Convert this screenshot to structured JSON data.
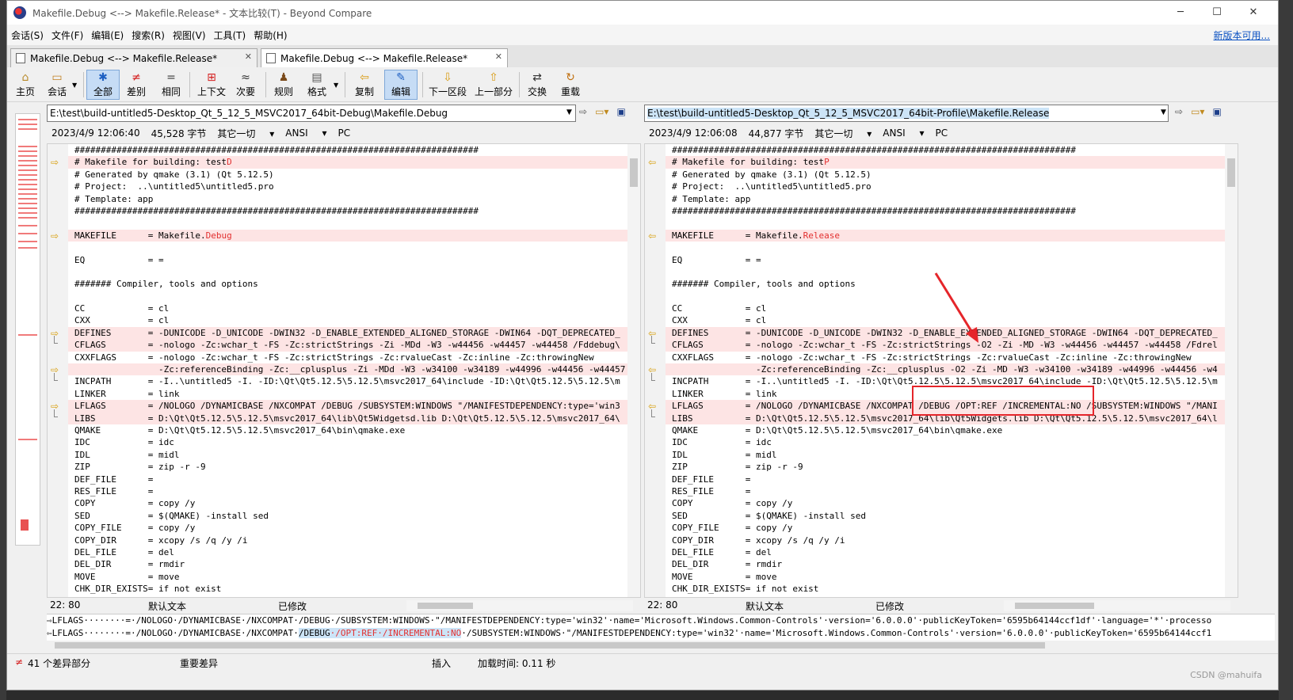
{
  "window": {
    "title": "Makefile.Debug <--> Makefile.Release* - 文本比较(T) - Beyond Compare",
    "controls": [
      "─",
      "☐",
      "✕"
    ]
  },
  "menu": {
    "items": [
      "会话(S)",
      "文件(F)",
      "编辑(E)",
      "搜索(R)",
      "视图(V)",
      "工具(T)",
      "帮助(H)"
    ],
    "update_link": "新版本可用..."
  },
  "tabs": [
    {
      "label": "Makefile.Debug <--> Makefile.Release*",
      "close": "✕"
    },
    {
      "label": "Makefile.Debug <--> Makefile.Release*",
      "close": "✕"
    }
  ],
  "toolbar": {
    "home": {
      "icon": "⌂",
      "label": "主页"
    },
    "session": {
      "icon": "▭",
      "label": "会话"
    },
    "all": {
      "icon": "✱",
      "label": "全部"
    },
    "diffs": {
      "icon": "≠",
      "label": "差别"
    },
    "same": {
      "icon": "=",
      "label": "相同"
    },
    "context": {
      "icon": "⊞",
      "label": "上下文"
    },
    "minor": {
      "icon": "≈",
      "label": "次要"
    },
    "rules": {
      "icon": "♟",
      "label": "规则"
    },
    "format": {
      "icon": "▤",
      "label": "格式"
    },
    "copy": {
      "icon": "⇦",
      "label": "复制"
    },
    "edit": {
      "icon": "✎",
      "label": "编辑"
    },
    "next_section": {
      "icon": "⇩",
      "label": "下一区段"
    },
    "prev_section": {
      "icon": "⇧",
      "label": "上一部分"
    },
    "swap": {
      "icon": "⇄",
      "label": "交换"
    },
    "reload": {
      "icon": "↻",
      "label": "重载"
    }
  },
  "left": {
    "path": "E:\\test\\build-untitled5-Desktop_Qt_5_12_5_MSVC2017_64bit-Debug\\Makefile.Debug",
    "datetime": "2023/4/9 12:06:40",
    "size": "45,528 字节",
    "options": "其它一切",
    "encoding": "ANSI",
    "lineend": "PC",
    "cursor": "22: 80",
    "text_type": "默认文本",
    "modified": "已修改"
  },
  "right": {
    "path": "E:\\test\\build-untitled5-Desktop_Qt_5_12_5_MSVC2017_64bit-Profile\\Makefile.Release",
    "datetime": "2023/4/9 12:06:08",
    "size": "44,877 字节",
    "options": "其它一切",
    "encoding": "ANSI",
    "lineend": "PC",
    "cursor": "22: 80",
    "text_type": "默认文本",
    "modified": "已修改"
  },
  "left_lines": [
    {
      "t": "#############################################################################",
      "d": false,
      "m": ""
    },
    {
      "t": "# Makefile for building: test",
      "x": "D",
      "d": true,
      "m": "arrow"
    },
    {
      "t": "# Generated by qmake (3.1) (Qt 5.12.5)",
      "d": false,
      "m": ""
    },
    {
      "t": "# Project:  ..\\untitled5\\untitled5.pro",
      "d": false,
      "m": ""
    },
    {
      "t": "# Template: app",
      "d": false,
      "m": ""
    },
    {
      "t": "#############################################################################",
      "d": false,
      "m": ""
    },
    {
      "t": "",
      "d": false,
      "m": ""
    },
    {
      "t": "MAKEFILE      = Makefile.",
      "x": "Debug",
      "d": true,
      "m": "arrow"
    },
    {
      "t": "",
      "d": false,
      "m": ""
    },
    {
      "t": "EQ            = =",
      "d": false,
      "m": ""
    },
    {
      "t": "",
      "d": false,
      "m": ""
    },
    {
      "t": "####### Compiler, tools and options",
      "d": false,
      "m": ""
    },
    {
      "t": "",
      "d": false,
      "m": ""
    },
    {
      "t": "CC            = cl",
      "d": false,
      "m": ""
    },
    {
      "t": "CXX           = cl",
      "d": false,
      "m": ""
    },
    {
      "t": "DEFINES       = -DUNICODE -D_UNICODE -DWIN32 -D_ENABLE_EXTENDED_ALIGNED_STORAGE -DWIN64 -DQT_DEPRECATED_",
      "d": true,
      "m": "arrow"
    },
    {
      "t": "CFLAGS        = -nologo -Zc:wchar_t -FS -Zc:strictStrings -Zi -MDd -W3 -w44456 -w44457 -w44458 /Fddebug\\",
      "d": true,
      "m": "bracket"
    },
    {
      "t": "CXXFLAGS      = -nologo -Zc:wchar_t -FS -Zc:strictStrings -Zc:rvalueCast -Zc:inline -Zc:throwingNew",
      "d": false,
      "m": ""
    },
    {
      "t": "                -Zc:referenceBinding -Zc:__cplusplus -Zi -MDd -W3 -w34100 -w34189 -w44996 -w44456 -w44457",
      "d": true,
      "m": "arrow"
    },
    {
      "t": "INCPATH       = -I..\\untitled5 -I. -ID:\\Qt\\Qt5.12.5\\5.12.5\\msvc2017_64\\include -ID:\\Qt\\Qt5.12.5\\5.12.5\\m",
      "d": false,
      "m": "bracket"
    },
    {
      "t": "LINKER        = link",
      "d": false,
      "m": ""
    },
    {
      "t": "LFLAGS        = /NOLOGO /DYNAMICBASE /NXCOMPAT /DEBUG /SUBSYSTEM:WINDOWS \"/MANIFESTDEPENDENCY:type='win3",
      "d": true,
      "m": "arrow"
    },
    {
      "t": "LIBS          = D:\\Qt\\Qt5.12.5\\5.12.5\\msvc2017_64\\lib\\Qt5Widgetsd.lib D:\\Qt\\Qt5.12.5\\5.12.5\\msvc2017_64\\",
      "d": true,
      "m": "bracket"
    },
    {
      "t": "QMAKE         = D:\\Qt\\Qt5.12.5\\5.12.5\\msvc2017_64\\bin\\qmake.exe",
      "d": false,
      "m": ""
    },
    {
      "t": "IDC           = idc",
      "d": false,
      "m": ""
    },
    {
      "t": "IDL           = midl",
      "d": false,
      "m": ""
    },
    {
      "t": "ZIP           = zip -r -9",
      "d": false,
      "m": ""
    },
    {
      "t": "DEF_FILE      =",
      "d": false,
      "m": ""
    },
    {
      "t": "RES_FILE      =",
      "d": false,
      "m": ""
    },
    {
      "t": "COPY          = copy /y",
      "d": false,
      "m": ""
    },
    {
      "t": "SED           = $(QMAKE) -install sed",
      "d": false,
      "m": ""
    },
    {
      "t": "COPY_FILE     = copy /y",
      "d": false,
      "m": ""
    },
    {
      "t": "COPY_DIR      = xcopy /s /q /y /i",
      "d": false,
      "m": ""
    },
    {
      "t": "DEL_FILE      = del",
      "d": false,
      "m": ""
    },
    {
      "t": "DEL_DIR       = rmdir",
      "d": false,
      "m": ""
    },
    {
      "t": "MOVE          = move",
      "d": false,
      "m": ""
    },
    {
      "t": "CHK_DIR_EXISTS= if not exist",
      "d": false,
      "m": ""
    }
  ],
  "right_lines": [
    {
      "t": "#############################################################################",
      "d": false,
      "m": ""
    },
    {
      "t": "# Makefile for building: test",
      "x": "P",
      "d": true,
      "m": "arrowl"
    },
    {
      "t": "# Generated by qmake (3.1) (Qt 5.12.5)",
      "d": false,
      "m": ""
    },
    {
      "t": "# Project:  ..\\untitled5\\untitled5.pro",
      "d": false,
      "m": ""
    },
    {
      "t": "# Template: app",
      "d": false,
      "m": ""
    },
    {
      "t": "#############################################################################",
      "d": false,
      "m": ""
    },
    {
      "t": "",
      "d": false,
      "m": ""
    },
    {
      "t": "MAKEFILE      = Makefile.",
      "x": "Release",
      "d": true,
      "m": "arrowl"
    },
    {
      "t": "",
      "d": false,
      "m": ""
    },
    {
      "t": "EQ            = =",
      "d": false,
      "m": ""
    },
    {
      "t": "",
      "d": false,
      "m": ""
    },
    {
      "t": "####### Compiler, tools and options",
      "d": false,
      "m": ""
    },
    {
      "t": "",
      "d": false,
      "m": ""
    },
    {
      "t": "CC            = cl",
      "d": false,
      "m": ""
    },
    {
      "t": "CXX           = cl",
      "d": false,
      "m": ""
    },
    {
      "t": "DEFINES       = -DUNICODE -D_UNICODE -DWIN32 -D_ENABLE_EXTENDED_ALIGNED_STORAGE -DWIN64 -DQT_DEPRECATED_",
      "d": true,
      "m": "arrowl"
    },
    {
      "t": "CFLAGS        = -nologo -Zc:wchar_t -FS -Zc:strictStrings -O2 -Zi -MD -W3 -w44456 -w44457 -w44458 /Fdrel",
      "d": true,
      "m": "bracket"
    },
    {
      "t": "CXXFLAGS      = -nologo -Zc:wchar_t -FS -Zc:strictStrings -Zc:rvalueCast -Zc:inline -Zc:throwingNew",
      "d": false,
      "m": ""
    },
    {
      "t": "                -Zc:referenceBinding -Zc:__cplusplus -O2 -Zi -MD -W3 -w34100 -w34189 -w44996 -w44456 -w4",
      "d": true,
      "m": "arrowl"
    },
    {
      "t": "INCPATH       = -I..\\untitled5 -I. -ID:\\Qt\\Qt5.12.5\\5.12.5\\msvc2017_64\\include -ID:\\Qt\\Qt5.12.5\\5.12.5\\m",
      "d": false,
      "m": "bracket"
    },
    {
      "t": "LINKER        = link",
      "d": false,
      "m": ""
    },
    {
      "t": "LFLAGS        = /NOLOGO /DYNAMICBASE /NXCOMPAT /DEBUG /OPT:REF /INCREMENTAL:NO /SUBSYSTEM:WINDOWS \"/MANI",
      "d": true,
      "m": "arrowl"
    },
    {
      "t": "LIBS          = D:\\Qt\\Qt5.12.5\\5.12.5\\msvc2017_64\\lib\\Qt5Widgets.lib D:\\Qt\\Qt5.12.5\\5.12.5\\msvc2017_64\\l",
      "d": true,
      "m": "bracket"
    },
    {
      "t": "QMAKE         = D:\\Qt\\Qt5.12.5\\5.12.5\\msvc2017_64\\bin\\qmake.exe",
      "d": false,
      "m": ""
    },
    {
      "t": "IDC           = idc",
      "d": false,
      "m": ""
    },
    {
      "t": "IDL           = midl",
      "d": false,
      "m": ""
    },
    {
      "t": "ZIP           = zip -r -9",
      "d": false,
      "m": ""
    },
    {
      "t": "DEF_FILE      =",
      "d": false,
      "m": ""
    },
    {
      "t": "RES_FILE      =",
      "d": false,
      "m": ""
    },
    {
      "t": "COPY          = copy /y",
      "d": false,
      "m": ""
    },
    {
      "t": "SED           = $(QMAKE) -install sed",
      "d": false,
      "m": ""
    },
    {
      "t": "COPY_FILE     = copy /y",
      "d": false,
      "m": ""
    },
    {
      "t": "COPY_DIR      = xcopy /s /q /y /i",
      "d": false,
      "m": ""
    },
    {
      "t": "DEL_FILE      = del",
      "d": false,
      "m": ""
    },
    {
      "t": "DEL_DIR       = rmdir",
      "d": false,
      "m": ""
    },
    {
      "t": "MOVE          = move",
      "d": false,
      "m": ""
    },
    {
      "t": "CHK_DIR_EXISTS= if not exist",
      "d": false,
      "m": ""
    }
  ],
  "bottom": {
    "left_prefix": "⇨LFLAGS········=·/NOLOGO·/DYNAMICBASE·/NXCOMPAT·/DEBUG·",
    "left_rest": "/SUBSYSTEM:WINDOWS·\"/MANIFESTDEPENDENCY:type='win32'·name='Microsoft.Windows.Common-Controls'·version='6.0.0.0'·publicKeyToken='6595b64144ccf1df'·language='*'·processo",
    "right_prefix": "⇦LFLAGS········=·/NOLOGO·/DYNAMICBASE·/NXCOMPAT·",
    "right_hl1": "/DEBUG",
    "right_hl2": "·/OPT:REF·/INCREMENTAL:NO",
    "right_rest": "·/SUBSYSTEM:WINDOWS·\"/MANIFESTDEPENDENCY:type='win32'·name='Microsoft.Windows.Common-Controls'·version='6.0.0.0'·publicKeyToken='6595b64144ccf1"
  },
  "statusbar": {
    "diff_icon": "≠",
    "diff_count": "41 个差异部分",
    "importance": "重要差异",
    "mode": "插入",
    "load_time": "加载时间:   0.11 秒"
  },
  "watermark": "CSDN @mahuifa"
}
